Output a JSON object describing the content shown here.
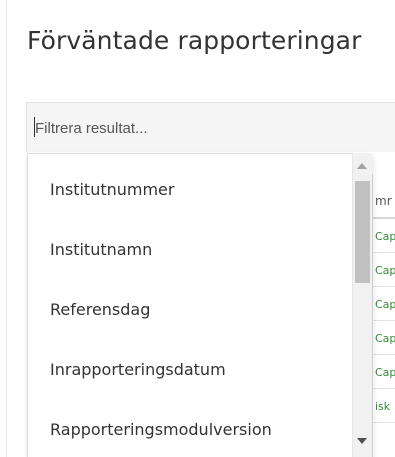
{
  "page": {
    "title": "Förväntade rapporteringar"
  },
  "filter": {
    "placeholder": "Filtrera resultat..."
  },
  "dropdown": {
    "items": [
      {
        "label": "Institutnummer"
      },
      {
        "label": "Institutnamn"
      },
      {
        "label": "Referensdag"
      },
      {
        "label": "Inrapporteringsdatum"
      },
      {
        "label": "Rapporteringsmodulversion"
      }
    ]
  },
  "table": {
    "header_fragment": "mr",
    "rows": [
      "Cap",
      "Cap",
      "Cap",
      "Cap",
      "Cap",
      "isk"
    ]
  },
  "colors": {
    "link_green": "#3a8a3a",
    "title_text": "#333333",
    "filter_bg": "#f5f5f5"
  },
  "icons": [
    "scroll-up-arrow-icon",
    "scroll-down-arrow-icon"
  ]
}
